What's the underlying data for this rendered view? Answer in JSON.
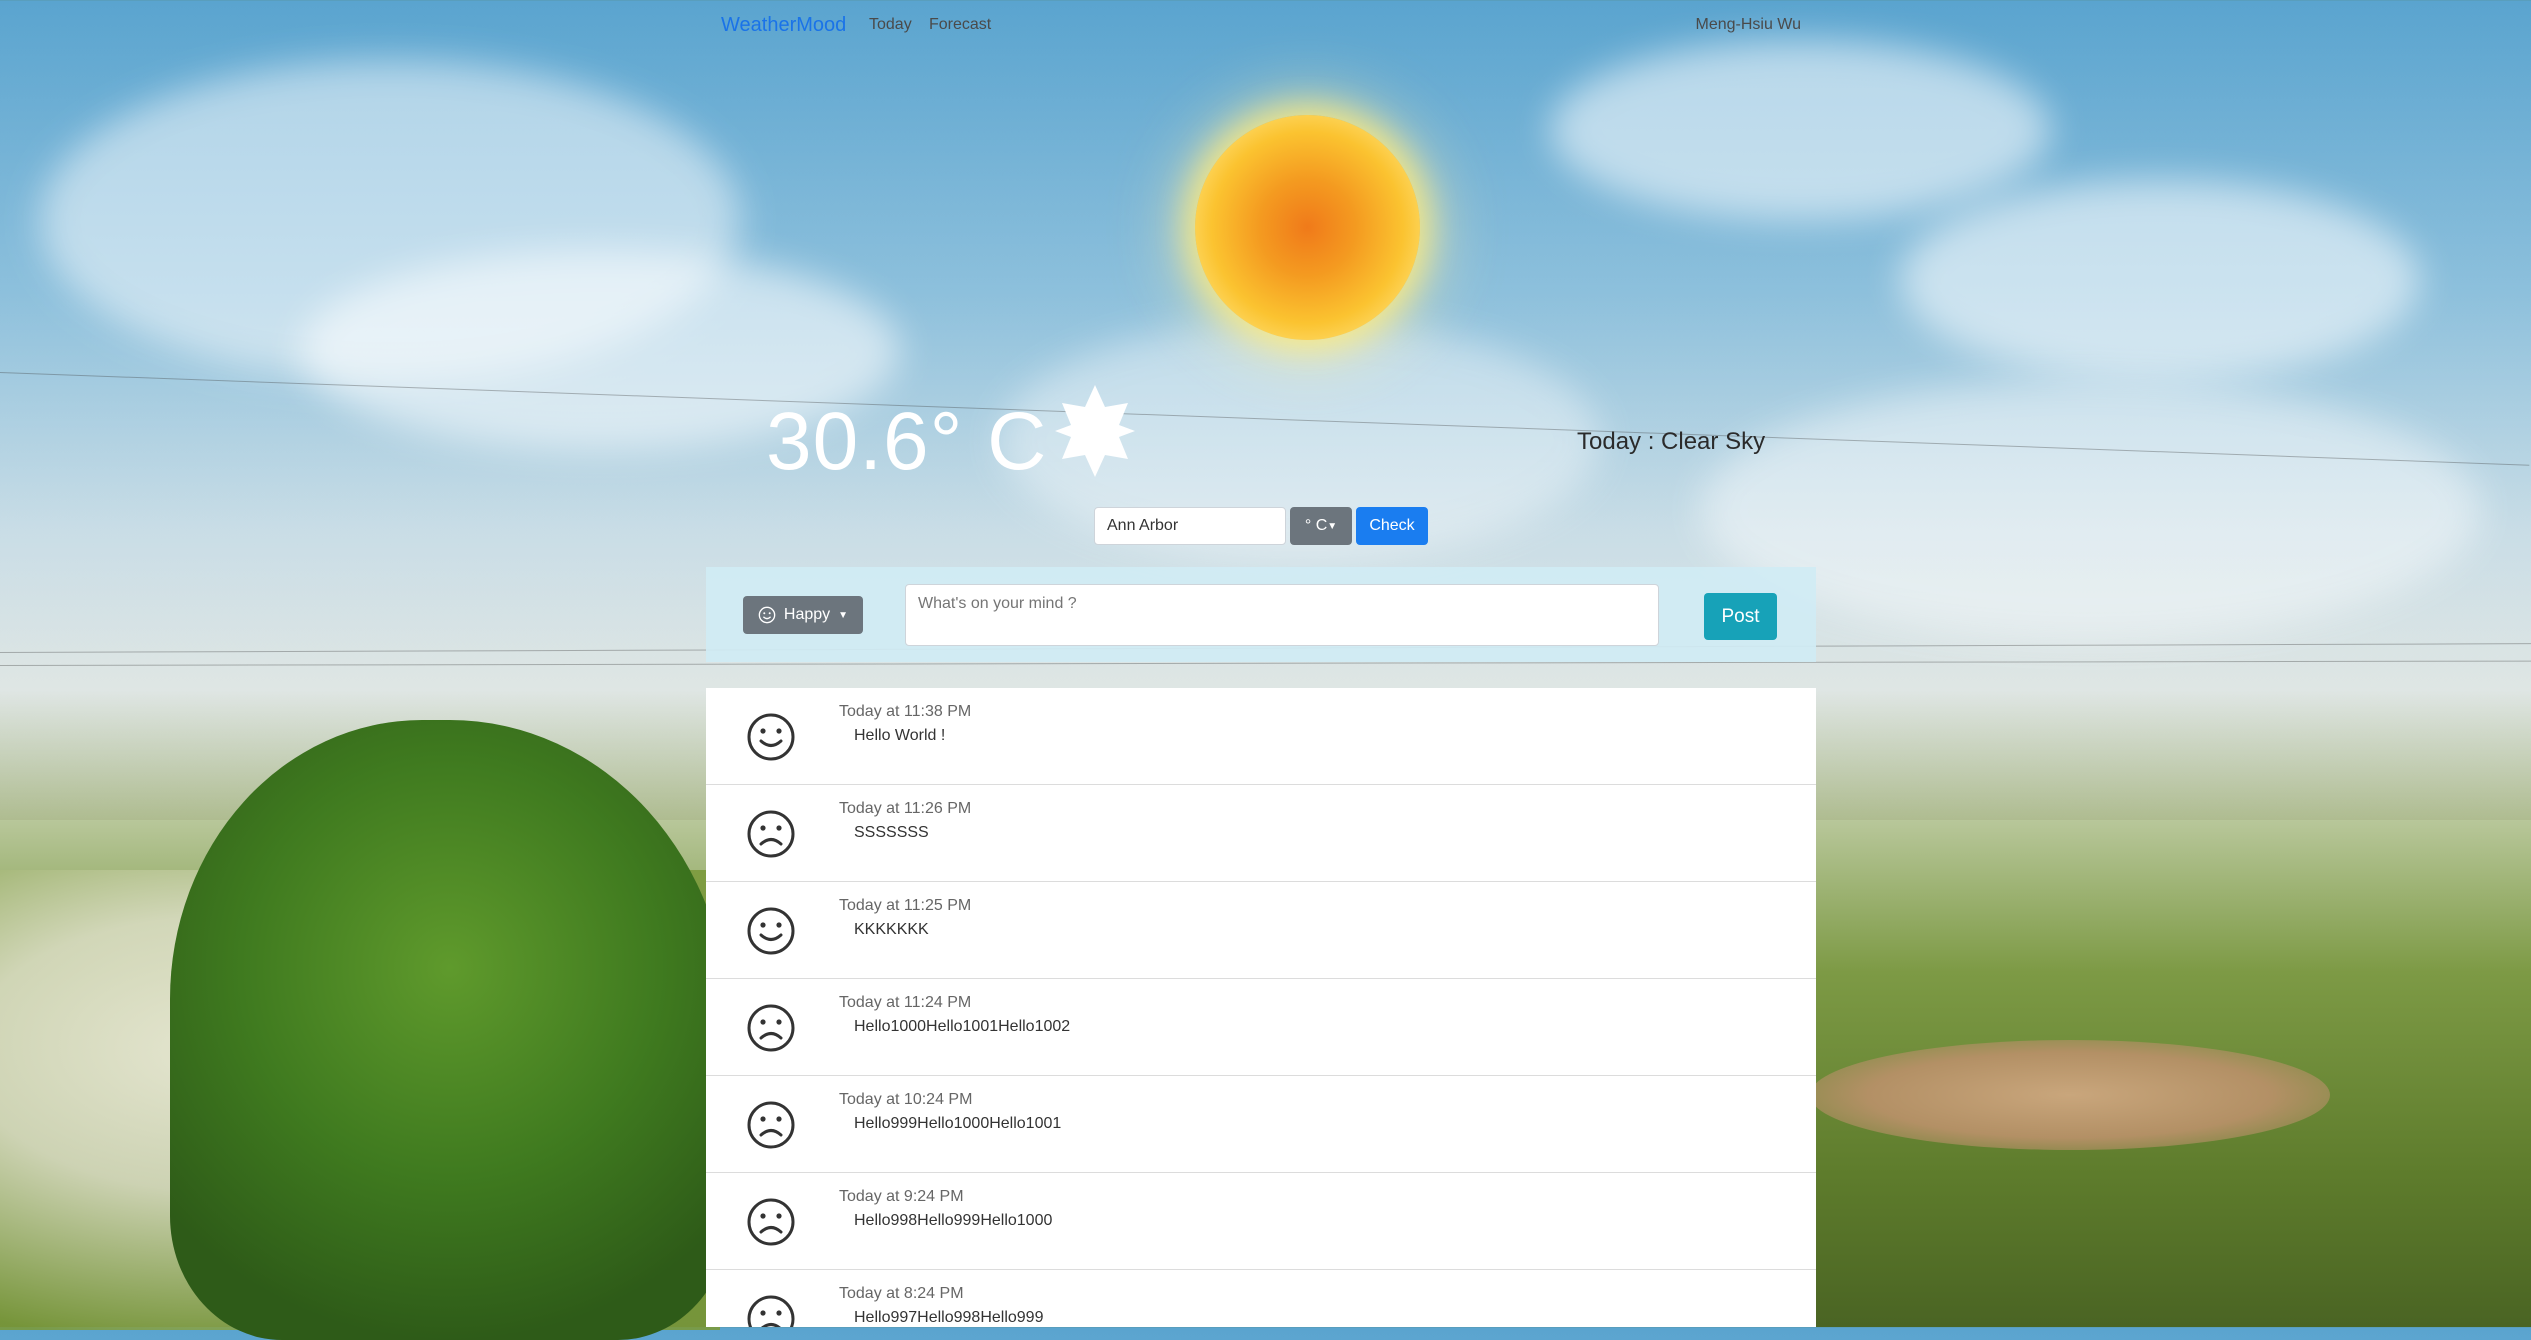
{
  "navbar": {
    "brand": "WeatherMood",
    "links": [
      "Today",
      "Forecast"
    ],
    "user": "Meng-Hsiu Wu"
  },
  "weather": {
    "temperature": "30.6° C",
    "condition_icon": "sun-star-icon",
    "summary": "Today : Clear Sky"
  },
  "search": {
    "city_value": "Ann Arbor",
    "unit_label": "° C",
    "check_label": "Check"
  },
  "composer": {
    "mood_label": "Happy",
    "mood_icon": "smiley-icon",
    "placeholder": "What's on your mind ?",
    "post_label": "Post"
  },
  "posts": [
    {
      "mood": "happy",
      "time": "Today at 11:38 PM",
      "text": "Hello World !"
    },
    {
      "mood": "sad",
      "time": "Today at 11:26 PM",
      "text": "SSSSSSS"
    },
    {
      "mood": "happy",
      "time": "Today at 11:25 PM",
      "text": "KKKKKKK"
    },
    {
      "mood": "sad",
      "time": "Today at 11:24 PM",
      "text": "Hello1000Hello1001Hello1002"
    },
    {
      "mood": "sad",
      "time": "Today at 10:24 PM",
      "text": "Hello999Hello1000Hello1001"
    },
    {
      "mood": "sad",
      "time": "Today at 9:24 PM",
      "text": "Hello998Hello999Hello1000"
    },
    {
      "mood": "sad",
      "time": "Today at 8:24 PM",
      "text": "Hello997Hello998Hello999"
    }
  ],
  "colors": {
    "brand": "#1a73e8",
    "check_button": "#1a7df0",
    "post_button": "#17a2b8",
    "secondary_button": "#6c757d",
    "composer_bg": "#d0ecf4"
  }
}
